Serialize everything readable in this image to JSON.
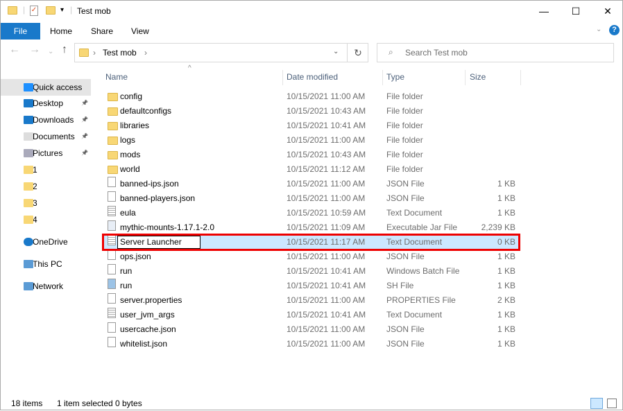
{
  "window": {
    "title": "Test mob",
    "minimize": "—",
    "maximize": "☐",
    "close": "✕"
  },
  "ribbon": {
    "tabs": [
      "File",
      "Home",
      "Share",
      "View"
    ],
    "help": "?"
  },
  "address": {
    "path": "Test mob",
    "refresh": "↻"
  },
  "search": {
    "placeholder": "Search Test mob"
  },
  "sidebar": [
    {
      "label": "Quick access",
      "icon": "star-icon"
    },
    {
      "label": "Desktop",
      "icon": "desktop-icon",
      "pinned": true
    },
    {
      "label": "Downloads",
      "icon": "download-icon",
      "pinned": true
    },
    {
      "label": "Documents",
      "icon": "documents-icon",
      "pinned": true
    },
    {
      "label": "Pictures",
      "icon": "pictures-icon",
      "pinned": true
    },
    {
      "label": "1",
      "icon": "folder-icon"
    },
    {
      "label": "2",
      "icon": "folder-icon"
    },
    {
      "label": "3",
      "icon": "folder-icon"
    },
    {
      "label": "4",
      "icon": "folder-icon"
    },
    {
      "label": "OneDrive",
      "icon": "cloud-icon"
    },
    {
      "label": "This PC",
      "icon": "computer-icon"
    },
    {
      "label": "Network",
      "icon": "network-icon"
    }
  ],
  "columns": {
    "name": "Name",
    "date": "Date modified",
    "type": "Type",
    "size": "Size"
  },
  "files": [
    {
      "name": "config",
      "date": "10/15/2021 11:00 AM",
      "type": "File folder",
      "size": "",
      "kind": "folder"
    },
    {
      "name": "defaultconfigs",
      "date": "10/15/2021 10:43 AM",
      "type": "File folder",
      "size": "",
      "kind": "folder"
    },
    {
      "name": "libraries",
      "date": "10/15/2021 10:41 AM",
      "type": "File folder",
      "size": "",
      "kind": "folder"
    },
    {
      "name": "logs",
      "date": "10/15/2021 11:00 AM",
      "type": "File folder",
      "size": "",
      "kind": "folder"
    },
    {
      "name": "mods",
      "date": "10/15/2021 10:43 AM",
      "type": "File folder",
      "size": "",
      "kind": "folder"
    },
    {
      "name": "world",
      "date": "10/15/2021 11:12 AM",
      "type": "File folder",
      "size": "",
      "kind": "folder"
    },
    {
      "name": "banned-ips.json",
      "date": "10/15/2021 11:00 AM",
      "type": "JSON File",
      "size": "1 KB",
      "kind": "file"
    },
    {
      "name": "banned-players.json",
      "date": "10/15/2021 11:00 AM",
      "type": "JSON File",
      "size": "1 KB",
      "kind": "file"
    },
    {
      "name": "eula",
      "date": "10/15/2021 10:59 AM",
      "type": "Text Document",
      "size": "1 KB",
      "kind": "text"
    },
    {
      "name": "mythic-mounts-1.17.1-2.0",
      "date": "10/15/2021 11:09 AM",
      "type": "Executable Jar File",
      "size": "2,239 KB",
      "kind": "jar"
    },
    {
      "name": "Server Launcher",
      "date": "10/15/2021 11:17 AM",
      "type": "Text Document",
      "size": "0 KB",
      "kind": "text",
      "selected": true,
      "renaming": true
    },
    {
      "name": "ops.json",
      "date": "10/15/2021 11:00 AM",
      "type": "JSON File",
      "size": "1 KB",
      "kind": "file"
    },
    {
      "name": "run",
      "date": "10/15/2021 10:41 AM",
      "type": "Windows Batch File",
      "size": "1 KB",
      "kind": "batch"
    },
    {
      "name": "run",
      "date": "10/15/2021 10:41 AM",
      "type": "SH File",
      "size": "1 KB",
      "kind": "sh"
    },
    {
      "name": "server.properties",
      "date": "10/15/2021 11:00 AM",
      "type": "PROPERTIES File",
      "size": "2 KB",
      "kind": "file"
    },
    {
      "name": "user_jvm_args",
      "date": "10/15/2021 10:41 AM",
      "type": "Text Document",
      "size": "1 KB",
      "kind": "text"
    },
    {
      "name": "usercache.json",
      "date": "10/15/2021 11:00 AM",
      "type": "JSON File",
      "size": "1 KB",
      "kind": "file"
    },
    {
      "name": "whitelist.json",
      "date": "10/15/2021 11:00 AM",
      "type": "JSON File",
      "size": "1 KB",
      "kind": "file"
    }
  ],
  "status": {
    "count": "18 items",
    "selection": "1 item selected",
    "size": "0 bytes"
  },
  "colors": {
    "accent": "#1979ca",
    "selection": "#cce8ff",
    "highlight": "#e00000"
  }
}
